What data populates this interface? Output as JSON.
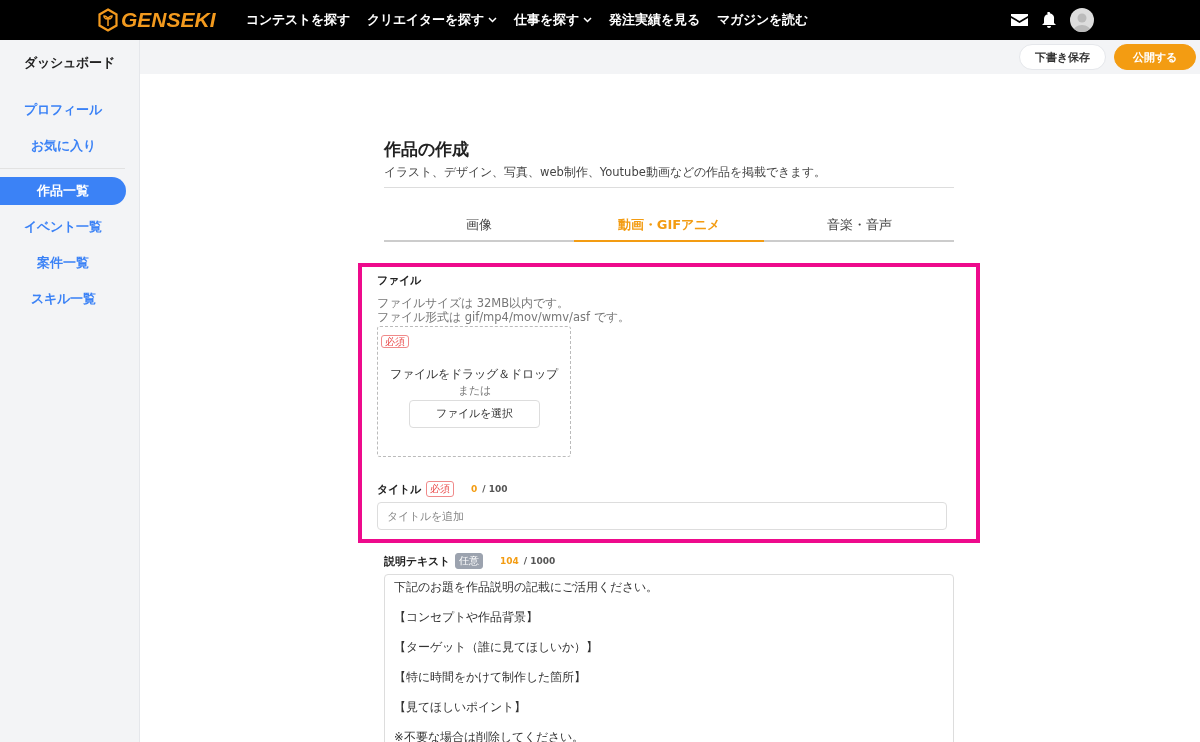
{
  "header": {
    "logo": "GENSEKI",
    "nav": [
      {
        "label": "コンテストを探す",
        "has_menu": false
      },
      {
        "label": "クリエイターを探す",
        "has_menu": true
      },
      {
        "label": "仕事を探す",
        "has_menu": true
      },
      {
        "label": "発注実績を見る",
        "has_menu": false
      },
      {
        "label": "マガジンを読む",
        "has_menu": false
      }
    ]
  },
  "sidebar": {
    "title": "ダッシュボード",
    "groups": [
      [
        {
          "label": "プロフィール",
          "selected": false
        },
        {
          "label": "お気に入り",
          "selected": false
        }
      ],
      [
        {
          "label": "作品一覧",
          "selected": true
        },
        {
          "label": "イベント一覧",
          "selected": false
        },
        {
          "label": "案件一覧",
          "selected": false
        },
        {
          "label": "スキル一覧",
          "selected": false
        }
      ]
    ]
  },
  "toolbar": {
    "buttons": [
      {
        "label": "下書き保存",
        "kind": "secondary"
      },
      {
        "label": "公開する",
        "kind": "primary"
      }
    ]
  },
  "page": {
    "title": "作品の作成",
    "subtitle": "イラスト、デザイン、写真、web制作、Youtube動画などの作品を掲載できます。"
  },
  "tabs": [
    {
      "label": "画像",
      "selected": false
    },
    {
      "label": "動画・GIFアニメ",
      "selected": true
    },
    {
      "label": "音楽・音声",
      "selected": false
    }
  ],
  "file": {
    "label": "ファイル",
    "notes": [
      "ファイルサイズは 32MB以内です。",
      "ファイル形式は gif/mp4/mov/wmv/asf です。"
    ],
    "badge": "必須",
    "drop_text": "ファイルをドラッグ＆ドロップ",
    "or": "または",
    "button": "ファイルを選択"
  },
  "title_field": {
    "label": "タイトル",
    "badge": "必須",
    "required": true,
    "count": "0",
    "max": "/ 100",
    "placeholder": "タイトルを追加"
  },
  "description": {
    "label": "説明テキスト",
    "badge": "任意",
    "required": false,
    "count": "104",
    "max": "/ 1000",
    "lines": [
      "下記のお題を作品説明の記載にご活用ください。",
      "【コンセプトや作品背景】",
      "【ターゲット（誰に見てほしいか）】",
      "【特に時間をかけて制作した箇所】",
      "【見てほしいポイント】",
      "※不要な場合は削除してください。"
    ]
  }
}
